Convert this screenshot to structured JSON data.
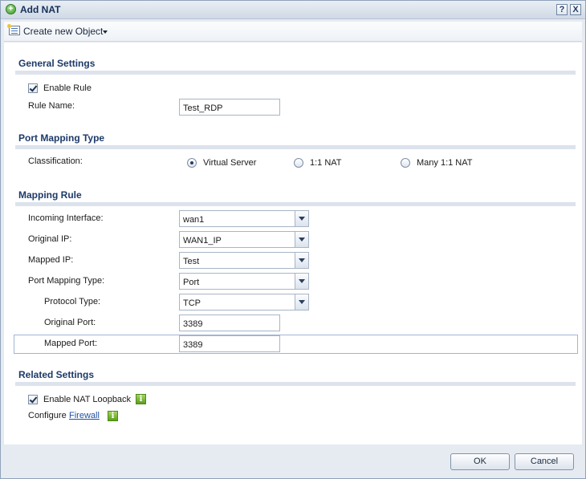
{
  "window": {
    "title": "Add NAT",
    "help_btn": "?",
    "close_btn": "X"
  },
  "toolbar": {
    "create_label": "Create new Object"
  },
  "general": {
    "heading": "General Settings",
    "enable_rule_label": "Enable Rule",
    "enable_rule_checked": true,
    "rule_name_label": "Rule Name:",
    "rule_name_value": "Test_RDP"
  },
  "port_mapping_type": {
    "heading": "Port Mapping Type",
    "classification_label": "Classification:",
    "options": [
      {
        "label": "Virtual Server",
        "selected": true
      },
      {
        "label": "1:1 NAT",
        "selected": false
      },
      {
        "label": "Many 1:1 NAT",
        "selected": false
      }
    ]
  },
  "mapping_rule": {
    "heading": "Mapping Rule",
    "incoming_interface_label": "Incoming Interface:",
    "incoming_interface_value": "wan1",
    "original_ip_label": "Original IP:",
    "original_ip_value": "WAN1_IP",
    "mapped_ip_label": "Mapped IP:",
    "mapped_ip_value": "Test",
    "port_mapping_type_label": "Port Mapping Type:",
    "port_mapping_type_value": "Port",
    "protocol_type_label": "Protocol Type:",
    "protocol_type_value": "TCP",
    "original_port_label": "Original Port:",
    "original_port_value": "3389",
    "mapped_port_label": "Mapped Port:",
    "mapped_port_value": "3389"
  },
  "related": {
    "heading": "Related Settings",
    "enable_nat_loopback_label": "Enable NAT Loopback",
    "enable_nat_loopback_checked": true,
    "configure_label": "Configure",
    "firewall_link": "Firewall",
    "info_glyph": "i"
  },
  "footer": {
    "ok_label": "OK",
    "cancel_label": "Cancel"
  },
  "colors": {
    "section_heading": "#1d3a68",
    "link": "#1f4fa3",
    "info_icon": "#5d9d1f",
    "title_icon": "#3f9a2c"
  }
}
